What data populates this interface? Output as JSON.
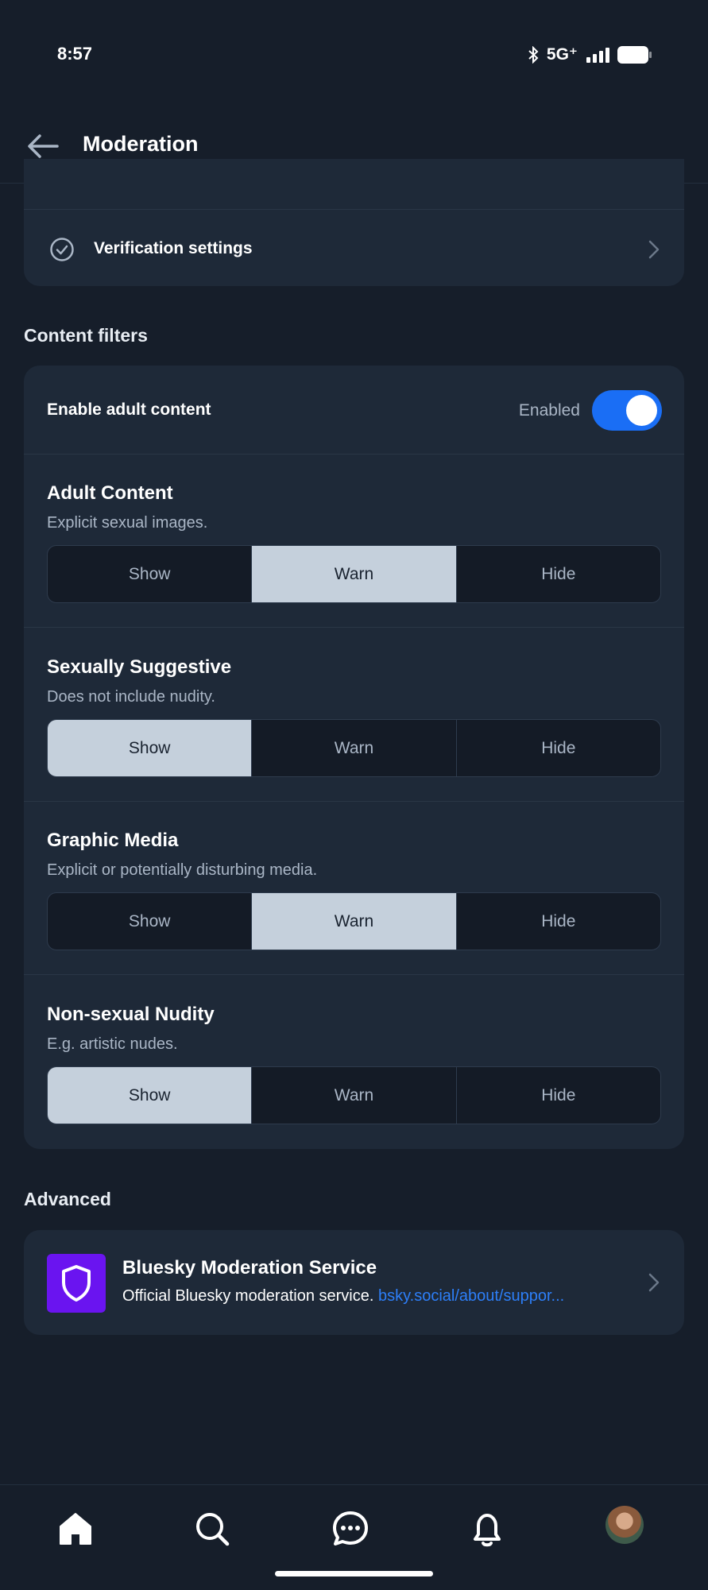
{
  "status_bar": {
    "time": "8:57",
    "network": "5G⁺"
  },
  "header": {
    "title": "Moderation"
  },
  "verification": {
    "label": "Verification settings"
  },
  "content_filters": {
    "section_title": "Content filters",
    "adult_toggle": {
      "label": "Enable adult content",
      "state_text": "Enabled",
      "on": true
    },
    "filters": [
      {
        "title": "Adult Content",
        "description": "Explicit sexual images.",
        "options": [
          "Show",
          "Warn",
          "Hide"
        ],
        "selected": "Warn"
      },
      {
        "title": "Sexually Suggestive",
        "description": "Does not include nudity.",
        "options": [
          "Show",
          "Warn",
          "Hide"
        ],
        "selected": "Show"
      },
      {
        "title": "Graphic Media",
        "description": "Explicit or potentially disturbing media.",
        "options": [
          "Show",
          "Warn",
          "Hide"
        ],
        "selected": "Warn"
      },
      {
        "title": "Non-sexual Nudity",
        "description": "E.g. artistic nudes.",
        "options": [
          "Show",
          "Warn",
          "Hide"
        ],
        "selected": "Show"
      }
    ]
  },
  "advanced": {
    "section_title": "Advanced",
    "service": {
      "name": "Bluesky Moderation Service",
      "description": "Official Bluesky moderation service.",
      "link": "bsky.social/about/suppor..."
    }
  },
  "tab_bar": {
    "items": [
      "home-icon",
      "search-icon",
      "chat-icon",
      "bell-icon",
      "avatar"
    ]
  },
  "colors": {
    "accent": "#1a6ef5",
    "background": "#161e2a",
    "card": "#1e2938",
    "service_logo": "#6a14f0",
    "link": "#2d7ff9"
  }
}
